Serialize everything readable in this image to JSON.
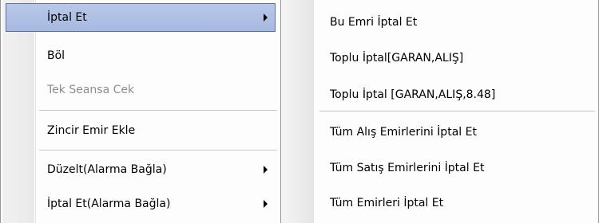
{
  "main_menu": {
    "items": [
      {
        "label": "İptal Et",
        "has_submenu": true,
        "state": "highlighted"
      },
      {
        "label": "Böl",
        "has_submenu": false,
        "state": "normal"
      },
      {
        "label": "Tek Seansa Cek",
        "has_submenu": false,
        "state": "disabled"
      },
      {
        "label": "Zincir Emir Ekle",
        "has_submenu": false,
        "state": "normal"
      },
      {
        "label": "Düzelt(Alarma Bağla)",
        "has_submenu": true,
        "state": "normal"
      },
      {
        "label": "İptal Et(Alarma Bağla)",
        "has_submenu": true,
        "state": "normal"
      }
    ]
  },
  "sub_menu": {
    "items": [
      {
        "label": "Bu Emri İptal Et"
      },
      {
        "label": "Toplu İptal[GARAN,ALIŞ]"
      },
      {
        "label": "Toplu İptal [GARAN,ALIŞ,8.48]"
      },
      {
        "label": "Tüm Alış Emirlerini İptal Et"
      },
      {
        "label": "Tüm Satış Emirlerini İptal Et"
      },
      {
        "label": "Tüm Emirleri İptal Et"
      }
    ]
  },
  "colors": {
    "highlight_fill": "#aebfe4",
    "highlight_border": "#5d6f9e",
    "disabled_text": "#8d8d8d"
  }
}
